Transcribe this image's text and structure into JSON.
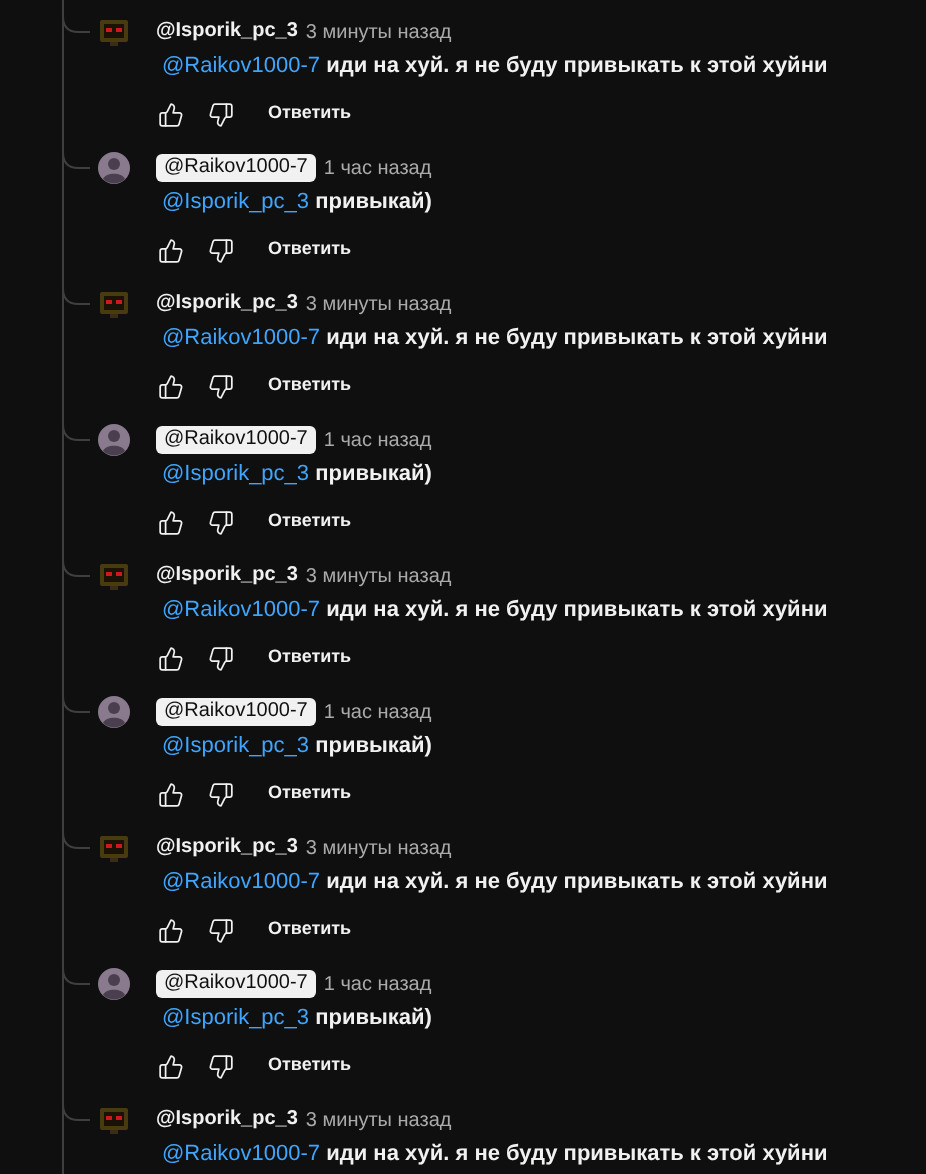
{
  "comments": [
    {
      "kind": "robot",
      "author": "@Isporik_pc_3",
      "highlighted": false,
      "time": "3 минуты назад",
      "mention": "@Raikov1000-7",
      "text": "иди на хуй. я не буду привыкать к этой хуйни",
      "reply_label": "Ответить"
    },
    {
      "kind": "person",
      "author": "@Raikov1000-7",
      "highlighted": true,
      "time": "1 час назад",
      "mention": "@Isporik_pc_3",
      "text": "привыкай)",
      "reply_label": "Ответить"
    },
    {
      "kind": "robot",
      "author": "@Isporik_pc_3",
      "highlighted": false,
      "time": "3 минуты назад",
      "mention": "@Raikov1000-7",
      "text": "иди на хуй. я не буду привыкать к этой хуйни",
      "reply_label": "Ответить"
    },
    {
      "kind": "person",
      "author": "@Raikov1000-7",
      "highlighted": true,
      "time": "1 час назад",
      "mention": "@Isporik_pc_3",
      "text": "привыкай)",
      "reply_label": "Ответить"
    },
    {
      "kind": "robot",
      "author": "@Isporik_pc_3",
      "highlighted": false,
      "time": "3 минуты назад",
      "mention": "@Raikov1000-7",
      "text": "иди на хуй. я не буду привыкать к этой хуйни",
      "reply_label": "Ответить"
    },
    {
      "kind": "person",
      "author": "@Raikov1000-7",
      "highlighted": true,
      "time": "1 час назад",
      "mention": "@Isporik_pc_3",
      "text": "привыкай)",
      "reply_label": "Ответить"
    },
    {
      "kind": "robot",
      "author": "@Isporik_pc_3",
      "highlighted": false,
      "time": "3 минуты назад",
      "mention": "@Raikov1000-7",
      "text": "иди на хуй. я не буду привыкать к этой хуйни",
      "reply_label": "Ответить"
    },
    {
      "kind": "person",
      "author": "@Raikov1000-7",
      "highlighted": true,
      "time": "1 час назад",
      "mention": "@Isporik_pc_3",
      "text": "привыкай)",
      "reply_label": "Ответить"
    },
    {
      "kind": "robot",
      "author": "@Isporik_pc_3",
      "highlighted": false,
      "time": "3 минуты назад",
      "mention": "@Raikov1000-7",
      "text": "иди на хуй. я не буду привыкать к этой хуйни"
    }
  ]
}
